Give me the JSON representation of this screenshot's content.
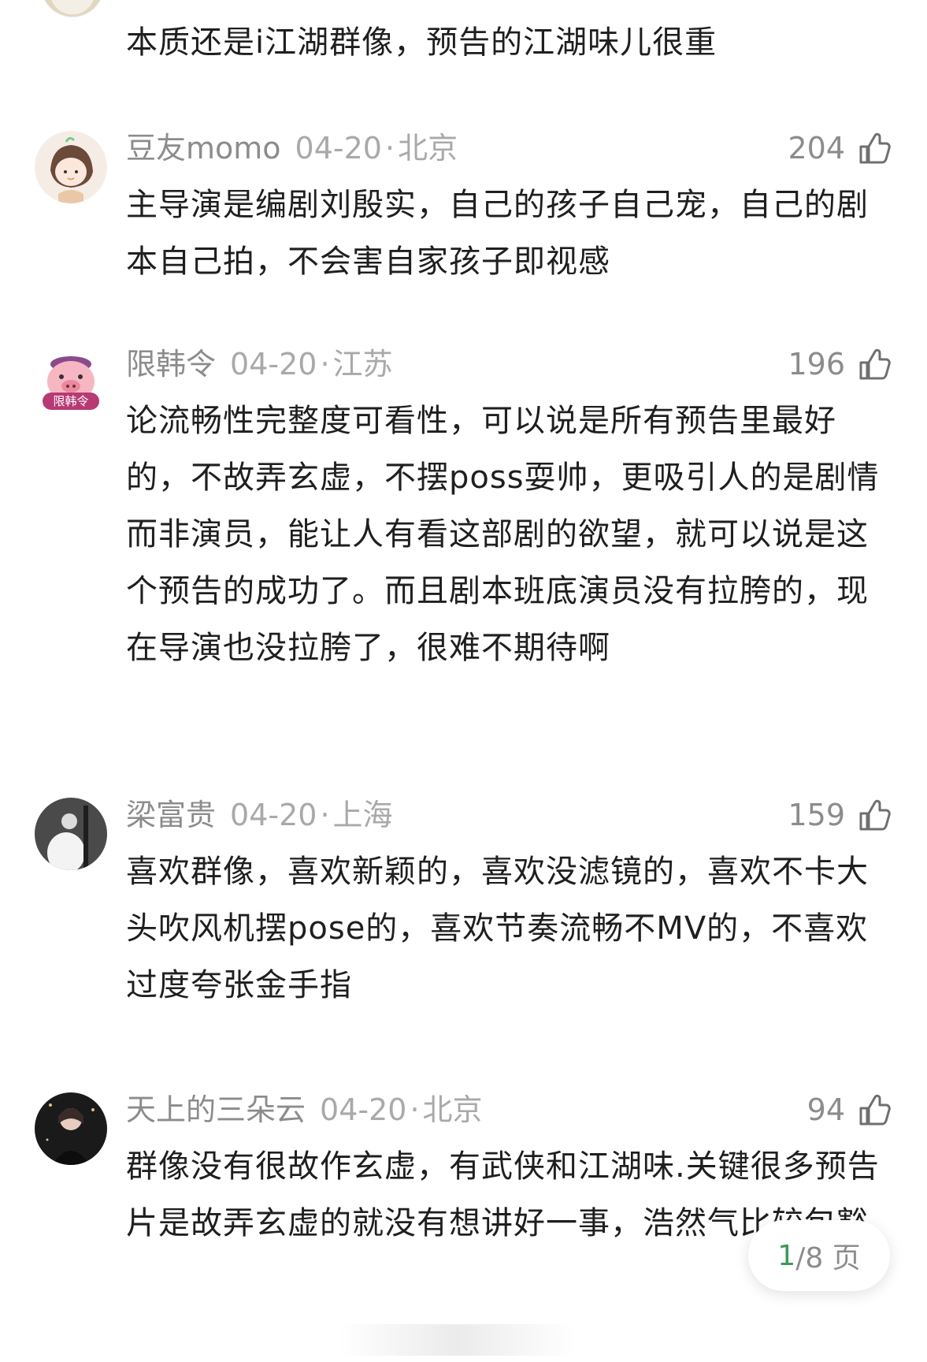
{
  "top_comment": {
    "text": "本质还是i江湖群像，预告的江湖味儿很重"
  },
  "comments": [
    {
      "user": "豆友momo",
      "date": "04-20",
      "sep": "·",
      "location": "北京",
      "likes": "204",
      "text": "主导演是编剧刘殷实，自己的孩子自己宠，自己的剧本自己拍，不会害自家孩子即视感"
    },
    {
      "user": "限韩令",
      "date": "04-20",
      "sep": "·",
      "location": "江苏",
      "likes": "196",
      "avatar_badge": "限韩令",
      "text": "论流畅性完整度可看性，可以说是所有预告里最好的，不故弄玄虚，不摆poss耍帅，更吸引人的是剧情而非演员，能让人有看这部剧的欲望，就可以说是这个预告的成功了。而且剧本班底演员没有拉胯的，现在导演也没拉胯了，很难不期待啊"
    },
    {
      "user": "梁富贵",
      "date": "04-20",
      "sep": "·",
      "location": "上海",
      "likes": "159",
      "text": "喜欢群像，喜欢新颖的，喜欢没滤镜的，喜欢不卡大头吹风机摆pose的，喜欢节奏流畅不MV的，不喜欢过度夸张金手指"
    },
    {
      "user": "天上的三朵云",
      "date": "04-20",
      "sep": "·",
      "location": "北京",
      "likes": "94",
      "text": "群像没有很故作玄虚，有武侠和江湖味.关键很多预告片是故弄玄虚的就没有想讲好一事，浩然气比较包豁"
    }
  ],
  "pager": {
    "current": "1",
    "total": "/8 页"
  },
  "colors": {
    "meta_gray": "#8c8c8c",
    "pager_accent": "#3a9a55"
  },
  "icons": {
    "like": "thumbs-up-icon"
  }
}
